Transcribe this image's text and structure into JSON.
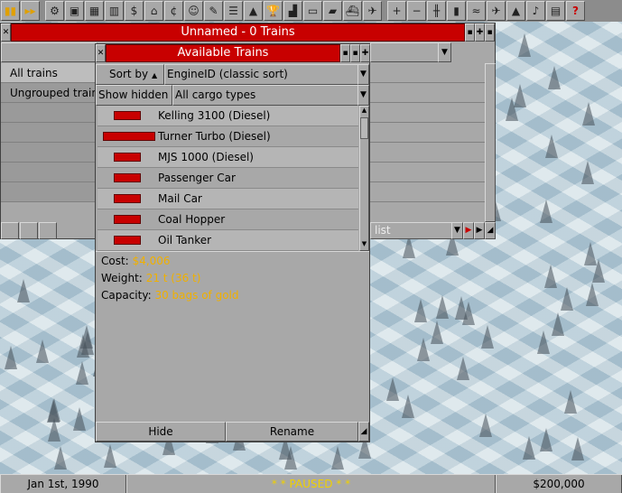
{
  "toolbar": {
    "icons": [
      {
        "name": "pause-icon",
        "glyph": "▮▮"
      },
      {
        "name": "fast-forward-icon",
        "glyph": "▸▸"
      },
      {
        "name": "settings-icon",
        "glyph": "⚙"
      },
      {
        "name": "save-icon",
        "glyph": "▣"
      },
      {
        "name": "map-icon",
        "glyph": "▦"
      },
      {
        "name": "town-directory-icon",
        "glyph": "▥"
      },
      {
        "name": "subsidies-icon",
        "glyph": "$"
      },
      {
        "name": "station-list-icon",
        "glyph": "⌂"
      },
      {
        "name": "finances-icon",
        "glyph": "¢"
      },
      {
        "name": "company-icon",
        "glyph": "☺"
      },
      {
        "name": "story-book-icon",
        "glyph": "✎"
      },
      {
        "name": "goal-list-icon",
        "glyph": "☰"
      },
      {
        "name": "graphs-icon",
        "glyph": "▲"
      },
      {
        "name": "league-table-icon",
        "glyph": "🏆"
      },
      {
        "name": "industries-icon",
        "glyph": "▟"
      },
      {
        "name": "train-list-icon",
        "glyph": "▭"
      },
      {
        "name": "road-vehicle-list-icon",
        "glyph": "▰"
      },
      {
        "name": "ship-list-icon",
        "glyph": "⛴"
      },
      {
        "name": "aircraft-list-icon",
        "glyph": "✈"
      },
      {
        "name": "zoom-in-icon",
        "glyph": "+"
      },
      {
        "name": "zoom-out-icon",
        "glyph": "−"
      },
      {
        "name": "build-railway-icon",
        "glyph": "╫"
      },
      {
        "name": "build-road-icon",
        "glyph": "▮"
      },
      {
        "name": "build-waterways-icon",
        "glyph": "≈"
      },
      {
        "name": "build-airport-icon",
        "glyph": "✈"
      },
      {
        "name": "landscaping-icon",
        "glyph": "▲"
      },
      {
        "name": "music-icon",
        "glyph": "♪"
      },
      {
        "name": "news-icon",
        "glyph": "▤"
      },
      {
        "name": "help-icon",
        "glyph": "?"
      }
    ]
  },
  "group_window": {
    "title": "Unnamed - 0 Trains",
    "groups": [
      "All trains",
      "Ungrouped trains"
    ],
    "sort_dropdown": "",
    "list_label": "list"
  },
  "avail_window": {
    "title": "Available Trains",
    "sort_by_label": "Sort by",
    "sort_criteria": "EngineID (classic sort)",
    "show_hidden_label": "Show hidden",
    "cargo_filter": "All cargo types",
    "trains": [
      {
        "name": "Kelling 3100 (Diesel)",
        "icon_width": 30
      },
      {
        "name": "Turner Turbo (Diesel)",
        "icon_width": 58
      },
      {
        "name": "MJS 1000 (Diesel)",
        "icon_width": 30
      },
      {
        "name": "Passenger Car",
        "icon_width": 30
      },
      {
        "name": "Mail Car",
        "icon_width": 30
      },
      {
        "name": "Coal Hopper",
        "icon_width": 30
      },
      {
        "name": "Oil Tanker",
        "icon_width": 30
      }
    ],
    "info": {
      "cost_label": "Cost:",
      "cost_value": "$4,006",
      "weight_label": "Weight:",
      "weight_value": "21 t (36 t)",
      "capacity_label": "Capacity:",
      "capacity_value": "30 bags of gold"
    },
    "hide_button": "Hide",
    "rename_button": "Rename"
  },
  "statusbar": {
    "date": "Jan 1st, 1990",
    "status": "* *  PAUSED  * *",
    "money": "$200,000"
  },
  "colors": {
    "title_red": "#c80000",
    "value_yellow": "#f0b000",
    "panel_grey": "#a8a8a8"
  }
}
